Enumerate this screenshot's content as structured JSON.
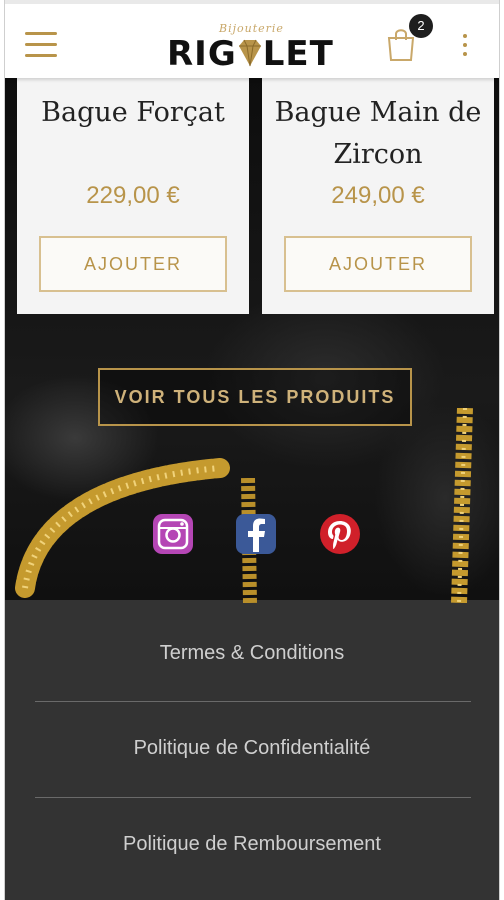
{
  "header": {
    "logo_script": "Bijouterie",
    "logo_text_left": "RIG",
    "logo_text_right": "LET",
    "cart_count": "2",
    "icons": {
      "menu": "hamburger-menu-icon",
      "cart": "shopping-bag-icon",
      "more": "kebab-menu-icon",
      "logo_gem": "diamond-icon"
    },
    "accent_color": "#b8944a"
  },
  "products": [
    {
      "name": "Bague Forçat",
      "price": "229,00 €",
      "button": "AJOUTER"
    },
    {
      "name": "Bague Main de Zircon",
      "price": "249,00 €",
      "button": "AJOUTER"
    }
  ],
  "view_all_button": "VOIR TOUS LES PRODUITS",
  "social": [
    {
      "icon": "instagram-icon",
      "color": "#b546b5"
    },
    {
      "icon": "facebook-icon",
      "color": "#3b5998"
    },
    {
      "icon": "pinterest-icon",
      "color": "#d0202a"
    }
  ],
  "footer": {
    "links": [
      "Termes & Conditions",
      "Politique de Confidentialité",
      "Politique de Remboursement"
    ],
    "background": "#333333"
  }
}
